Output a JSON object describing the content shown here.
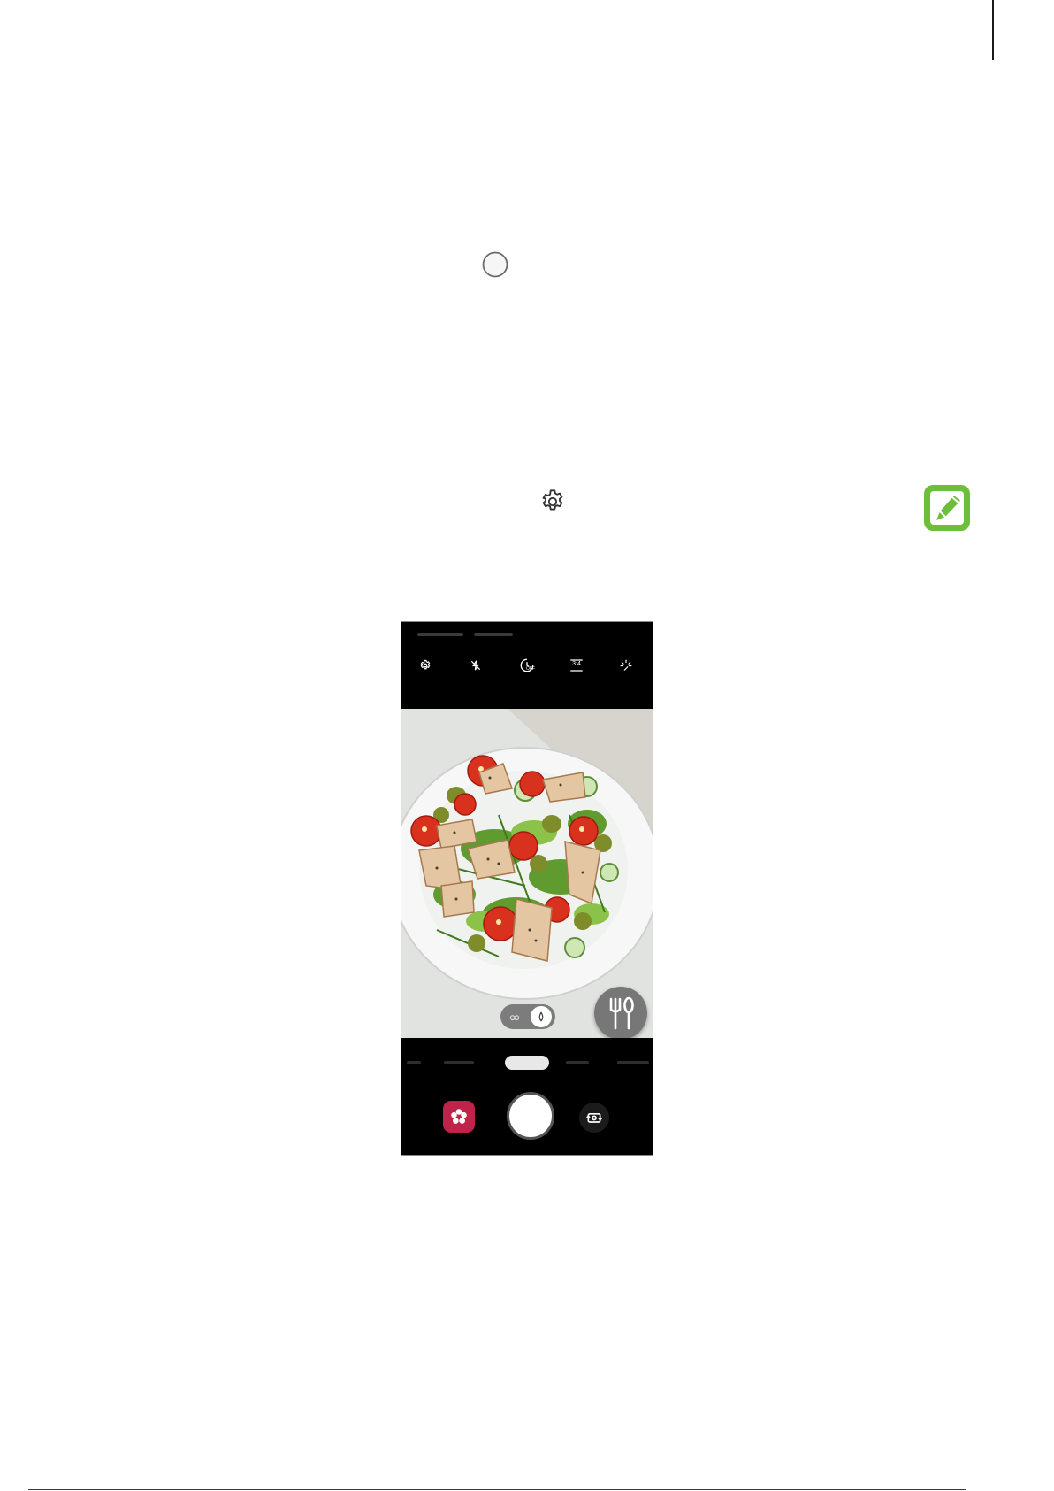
{
  "colors": {
    "note_icon": "#6dbf3b",
    "gallery_button": "#c0234a",
    "phone_background": "#000000",
    "viewfinder_background": "#e2e5e2"
  },
  "icons": {
    "inline_shutter": "shutter-circle-icon",
    "inline_settings": "gear-icon",
    "note": "note-pencil-icon"
  },
  "phone": {
    "toolbar": {
      "aspect_ratio_label": "3:4",
      "timer_label": "OFF",
      "icons": [
        "gear-icon",
        "flash-off-icon",
        "timer-off-icon",
        "aspect-ratio-icon",
        "effects-icon"
      ]
    },
    "viewfinder": {
      "subject": "salad-plate-image",
      "food_toggle_state": "on"
    },
    "bottom_bar": {
      "icons": [
        "gallery-flower-icon",
        "shutter-icon",
        "switch-camera-icon"
      ]
    }
  }
}
